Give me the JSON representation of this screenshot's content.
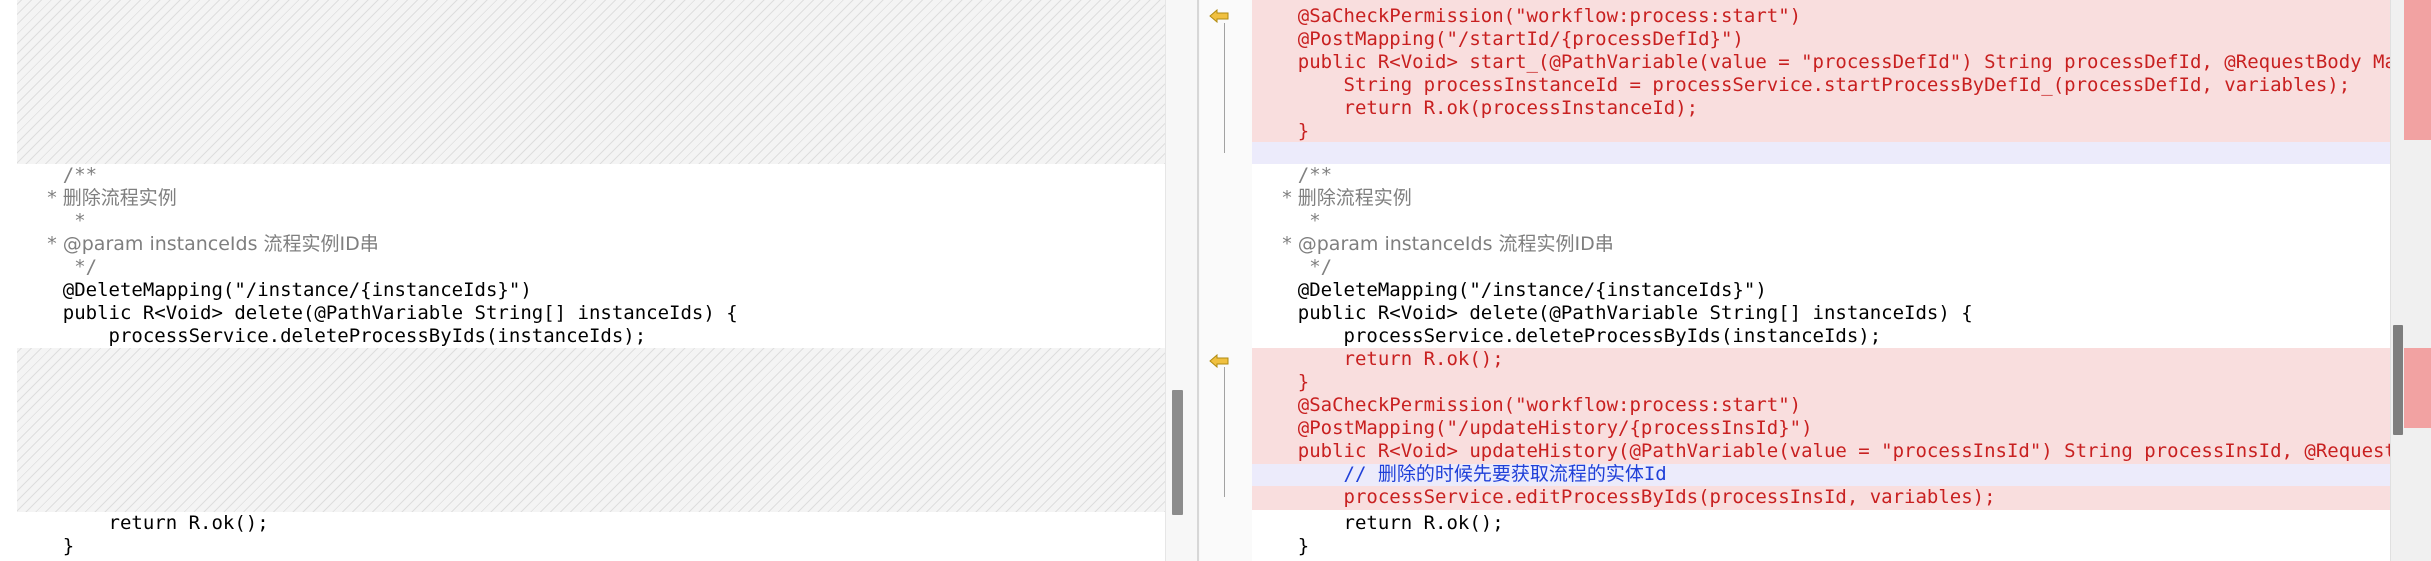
{
  "left": {
    "lines": [
      "    /**",
      "     * 删除流程实例",
      "     *",
      "     * @param instanceIds 流程实例ID串",
      "     */",
      "    @DeleteMapping(\"/instance/{instanceIds}\")",
      "    public R<Void> delete(@PathVariable String[] instanceIds) {",
      "        processService.deleteProcessByIds(instanceIds);",
      "        return R.ok();",
      "    }"
    ]
  },
  "right": {
    "lines": [
      "    @SaCheckPermission(\"workflow:process:start\")",
      "    @PostMapping(\"/startId/{processDefId}\")",
      "    public R<Void> start_(@PathVariable(value = \"processDefId\") String processDefId, @RequestBody Map<St",
      "        String processInstanceId = processService.startProcessByDefId_(processDefId, variables);",
      "        return R.ok(processInstanceId);",
      "    }",
      "    /**",
      "     * 删除流程实例",
      "     *",
      "     * @param instanceIds 流程实例ID串",
      "     */",
      "    @DeleteMapping(\"/instance/{instanceIds}\")",
      "    public R<Void> delete(@PathVariable String[] instanceIds) {",
      "        processService.deleteProcessByIds(instanceIds);",
      "        return R.ok();",
      "    }",
      "    @SaCheckPermission(\"workflow:process:start\")",
      "    @PostMapping(\"/updateHistory/{processInsId}\")",
      "    public R<Void> updateHistory(@PathVariable(value = \"processInsId\") String processInsId, @RequestBody",
      "        // 删除的时候先要获取流程的实体Id",
      "        processService.editProcessByIds(processInsId, variables);",
      "        return R.ok();",
      "    }"
    ]
  },
  "colors": {
    "deleted_bg": "#fde5e5",
    "removed_text": "#c82020",
    "comment_blue": "#2040d8",
    "string_green": "#2a7a2a"
  }
}
